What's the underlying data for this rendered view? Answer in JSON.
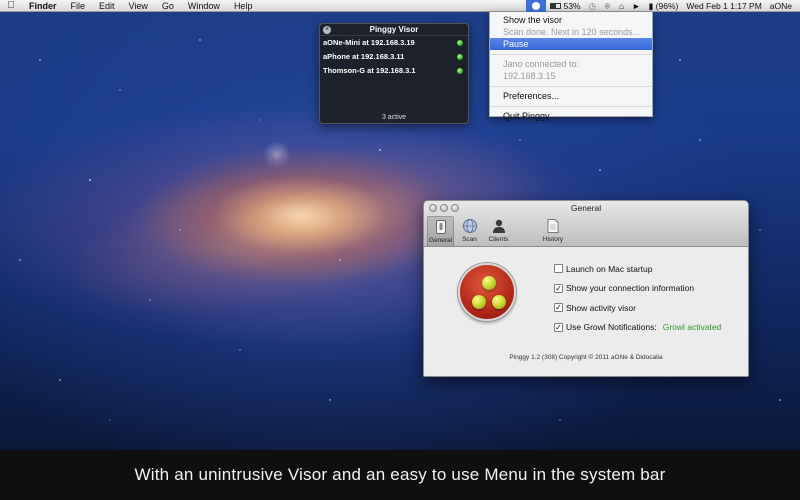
{
  "menubar": {
    "apple_icon": "apple-icon",
    "app_name": "Finder",
    "menus": [
      "File",
      "Edit",
      "View",
      "Go",
      "Window",
      "Help"
    ],
    "battery_percent": "53%",
    "battery_level": 0.53,
    "power_text": "(96%)",
    "clock": "Wed Feb 1  1:17 PM",
    "user": "aONe"
  },
  "dropdown": {
    "items": [
      {
        "label": "Show the visor",
        "state": "enabled"
      },
      {
        "label": "Scan done. Next in 120 seconds...",
        "state": "disabled"
      },
      {
        "label": "Pause",
        "state": "selected"
      },
      {
        "label": "Jano connected to:",
        "state": "disabled"
      },
      {
        "label": "192.168.3.15",
        "state": "disabled"
      },
      {
        "label": "Preferences...",
        "state": "enabled"
      },
      {
        "label": "Quit Pinggy",
        "state": "enabled"
      }
    ]
  },
  "visor": {
    "title": "Pinggy Visor",
    "hosts": [
      {
        "label": "aONe-Mini at 192.168.3.19",
        "status": "online"
      },
      {
        "label": "aPhone at 192.168.3.11",
        "status": "online"
      },
      {
        "label": "Thomson-G at 192.168.3.1",
        "status": "online"
      }
    ],
    "footer": "3 active"
  },
  "prefs": {
    "title": "General",
    "tabs": [
      {
        "label": "General",
        "icon": "switch-icon",
        "active": true
      },
      {
        "label": "Scan",
        "icon": "globe-icon",
        "active": false
      },
      {
        "label": "Clients",
        "icon": "person-icon",
        "active": false
      },
      {
        "label": "History",
        "icon": "document-icon",
        "active": false
      }
    ],
    "options": [
      {
        "label": "Launch on Mac startup",
        "checked": false
      },
      {
        "label": "Show your connection information",
        "checked": true
      },
      {
        "label": "Show activity visor",
        "checked": true
      },
      {
        "label": "Use Growl Notifications:",
        "checked": true
      }
    ],
    "growl_status": "Growl activated",
    "copyright": "Pinggy 1.2 (308) Copyright © 2011 aONe & Didocalia",
    "colors": {
      "growl_status": "#2e9a2e",
      "indicator": "#2fb52f"
    }
  },
  "caption": "With an unintrusive Visor and an easy to use Menu in the system bar"
}
